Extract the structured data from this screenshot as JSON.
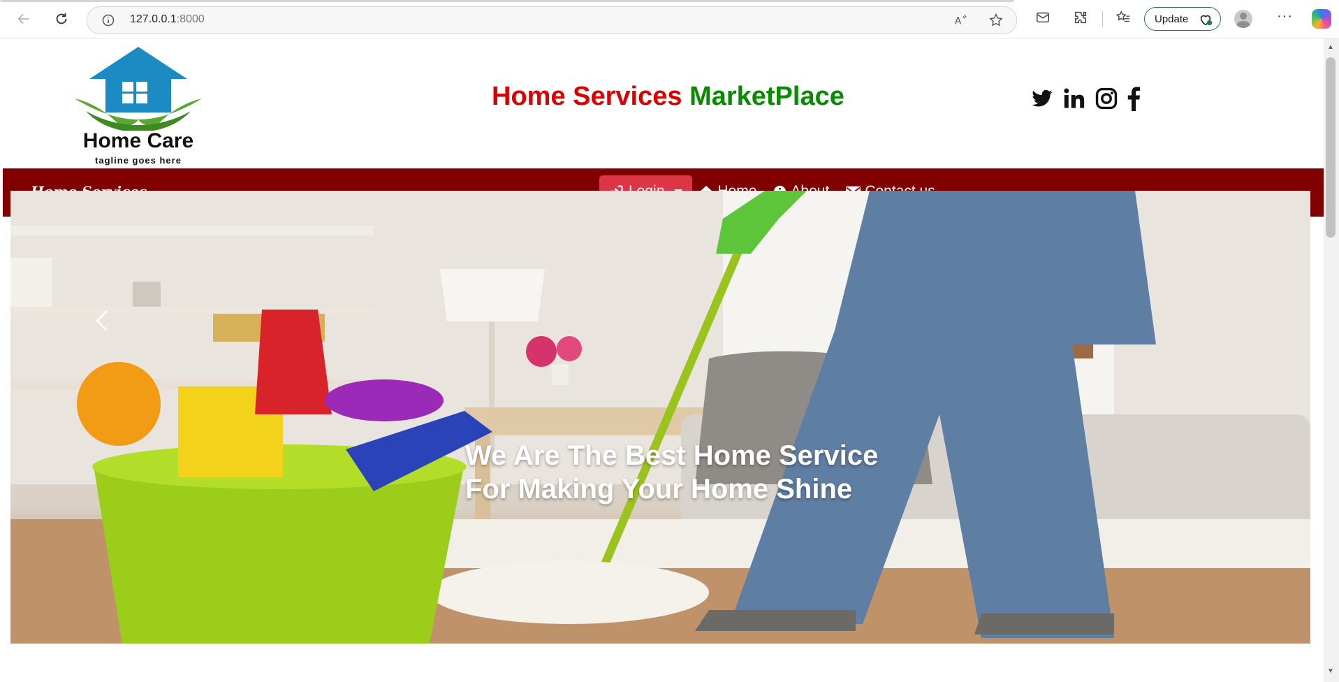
{
  "browser": {
    "url_host": "127.0.0.1",
    "url_port": ":8000",
    "update_label": "Update"
  },
  "header": {
    "logo_name": "Home Care",
    "logo_tagline": "tagline goes here",
    "title_part1": "Home Services",
    "title_part2": "MarketPlace",
    "title_colors": {
      "part1": "#d90000",
      "part2": "#0a8a00"
    },
    "socials": [
      "twitter-icon",
      "linkedin-icon",
      "instagram-icon",
      "facebook-icon"
    ]
  },
  "navbar": {
    "brand": "Home Services",
    "background": "#800000",
    "login_label": "Login",
    "login_color": "#dc3545",
    "links": [
      {
        "icon": "home-icon",
        "label": "Home"
      },
      {
        "icon": "info-icon",
        "label": "About"
      },
      {
        "icon": "envelope-icon",
        "label": "Contact us"
      }
    ]
  },
  "hero": {
    "caption_line1": "We Are The Best Home Service",
    "caption_line2": "For Making Your Home Shine"
  }
}
